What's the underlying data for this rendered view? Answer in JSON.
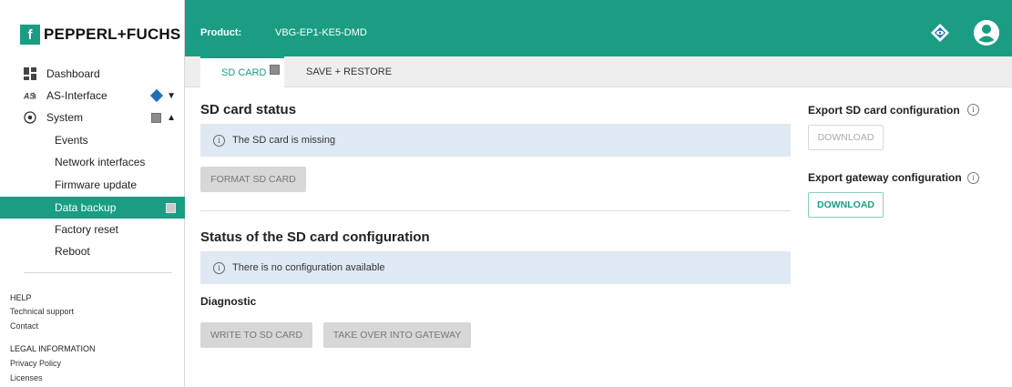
{
  "brand": {
    "mark": "f",
    "name": "PEPPERL+FUCHS"
  },
  "header": {
    "product_label": "Product:",
    "product_value": "VBG-EP1-KE5-DMD"
  },
  "sidebar": {
    "items": [
      {
        "label": "Dashboard",
        "icon": "dashboard-icon"
      },
      {
        "label": "AS-Interface",
        "icon": "as-interface-icon"
      },
      {
        "label": "System",
        "icon": "radio-circle-icon"
      },
      {
        "label": "Events"
      },
      {
        "label": "Network interfaces"
      },
      {
        "label": "Firmware update"
      },
      {
        "label": "Data backup"
      },
      {
        "label": "Factory reset"
      },
      {
        "label": "Reboot"
      }
    ],
    "help_heading": "HELP",
    "help_links": [
      "Technical support",
      "Contact"
    ],
    "legal_heading": "LEGAL INFORMATION",
    "legal_links": [
      "Privacy Policy",
      "Licenses"
    ]
  },
  "tabs": [
    {
      "label": "SD CARD"
    },
    {
      "label": "SAVE + RESTORE"
    }
  ],
  "main": {
    "sd_status_title": "SD card status",
    "sd_status_message": "The SD card is missing",
    "format_button": "FORMAT SD CARD",
    "config_status_title": "Status of the SD card configuration",
    "config_status_message": "There is no configuration available",
    "diagnostic_title": "Diagnostic",
    "write_button": "WRITE TO SD CARD",
    "takeover_button": "TAKE OVER INTO GATEWAY"
  },
  "right_panel": {
    "export_sd_title": "Export SD card configuration",
    "export_sd_button": "DOWNLOAD",
    "export_gw_title": "Export gateway configuration",
    "export_gw_button": "DOWNLOAD"
  },
  "colors": {
    "accent": "#1a9d83",
    "info_bg": "#dfe9f4",
    "diamond_blue": "#1f6fb8"
  }
}
